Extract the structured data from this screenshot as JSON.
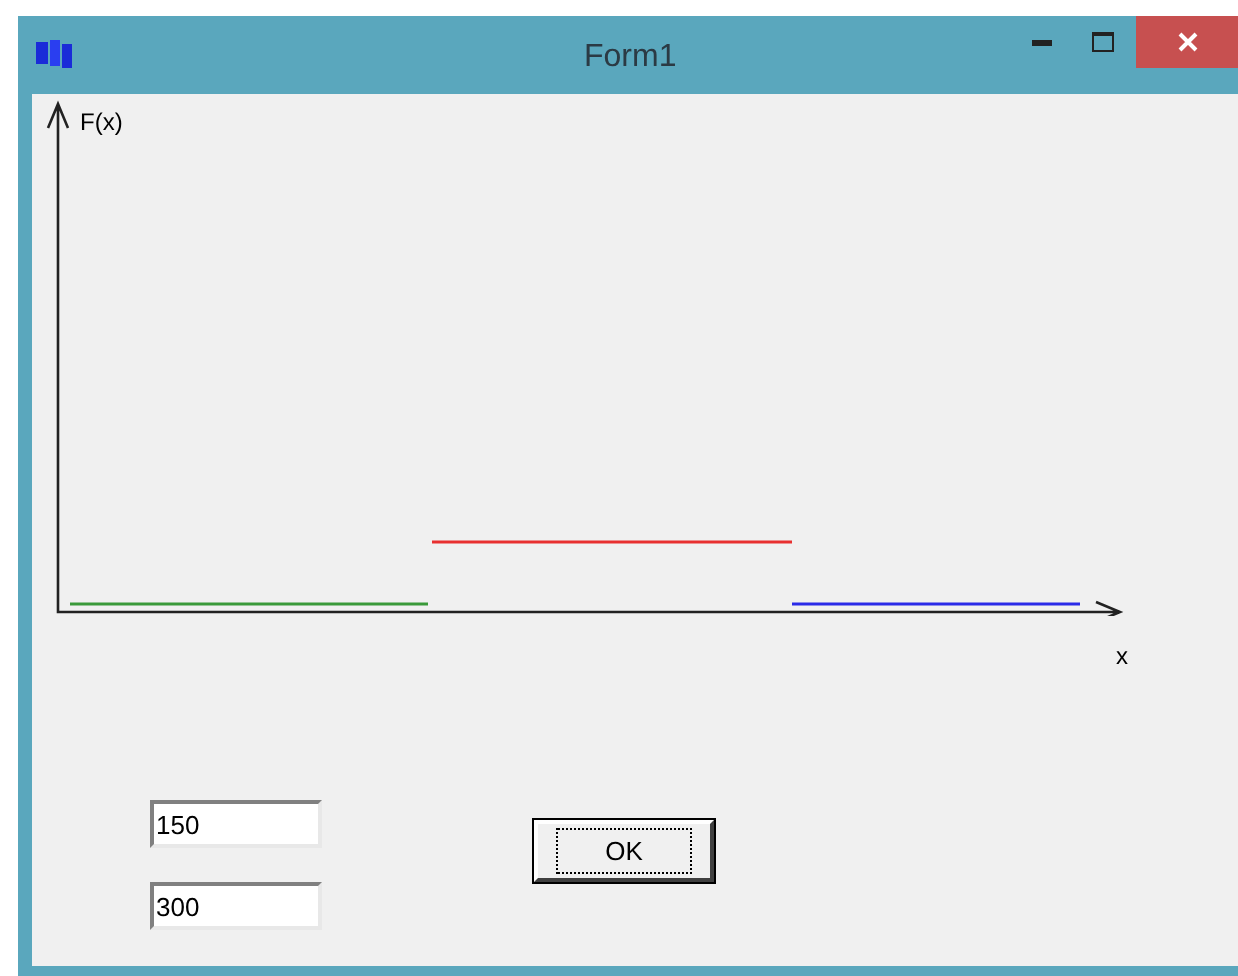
{
  "window": {
    "title": "Form1"
  },
  "plot": {
    "ylabel": "F(x)",
    "xlabel": "x"
  },
  "fields": [
    {
      "value": "150"
    },
    {
      "value": "300"
    }
  ],
  "button": {
    "label": "OK"
  }
}
